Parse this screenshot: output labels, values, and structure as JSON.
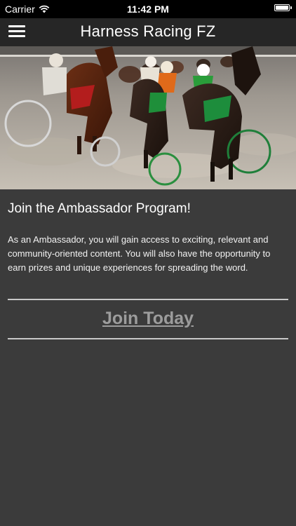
{
  "status_bar": {
    "carrier": "Carrier",
    "time": "11:42 PM",
    "battery_level": 1.0
  },
  "nav": {
    "title": "Harness Racing FZ",
    "menu_icon": "hamburger-menu-icon"
  },
  "hero": {
    "image_subject": "harness-racing-photo"
  },
  "main": {
    "headline": "Join the Ambassador Program!",
    "description": "As an Ambassador, you will gain access to exciting, relevant and community-oriented content. You will also have the opportunity to earn prizes and unique experiences for spreading the word.",
    "cta_label": "Join Today"
  },
  "colors": {
    "background": "#3b3b3b",
    "nav_background": "#262626",
    "status_background": "#000000",
    "cta_text": "#9c9c9c",
    "divider": "#c8c8c8"
  }
}
